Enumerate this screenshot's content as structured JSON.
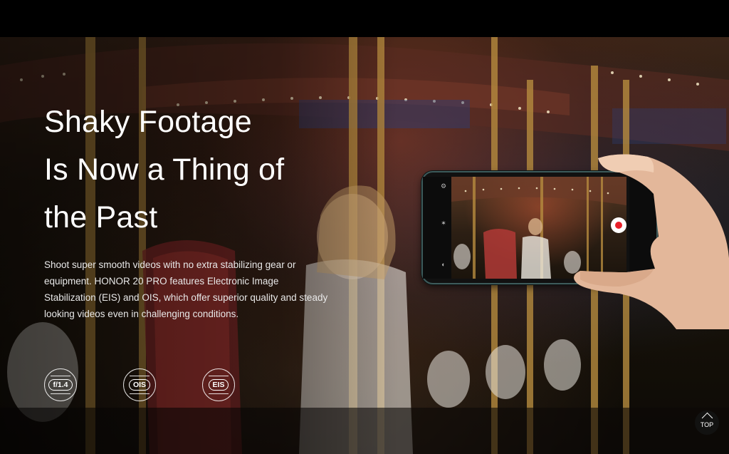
{
  "hero": {
    "title_lines": [
      "Shaky Footage",
      "Is Now a Thing of",
      "the Past"
    ],
    "description": "Shoot super smooth videos with no extra stabilizing gear or equipment. HONOR 20 PRO features Electronic Image Stabilization (EIS) and OIS, which offer superior quality and steady looking videos even in challenging conditions."
  },
  "badges": [
    {
      "label": "f/1.4",
      "icon": "aperture-badge-icon"
    },
    {
      "label": "OIS",
      "icon": "ois-badge-icon"
    },
    {
      "label": "EIS",
      "icon": "eis-badge-icon"
    }
  ],
  "top_button": {
    "label": "TOP",
    "icon": "arrow-up-icon"
  },
  "colors": {
    "background": "#000000",
    "text": "#ffffff",
    "record": "#e8202a",
    "phone_frame": "#3d5a5a"
  }
}
